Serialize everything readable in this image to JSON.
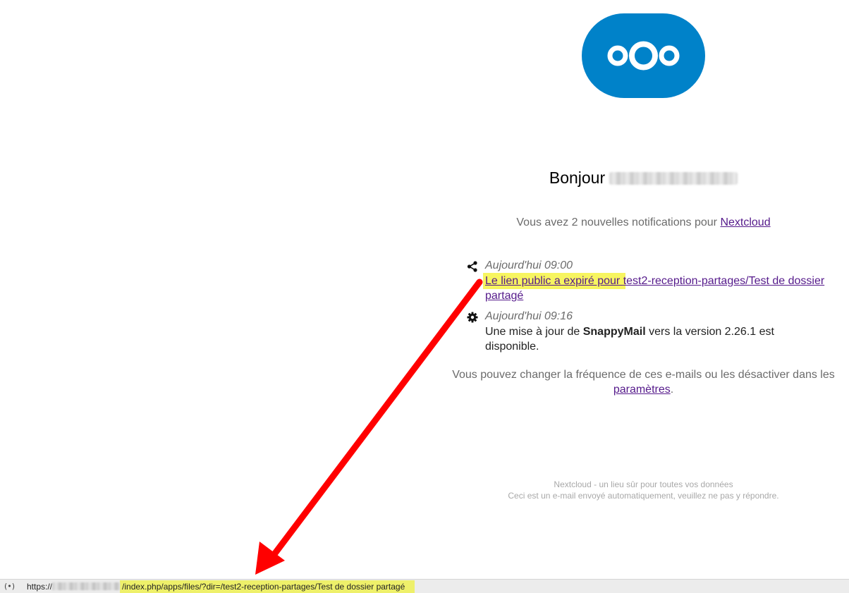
{
  "greeting": {
    "prefix": "Bonjour"
  },
  "intro": {
    "text": "Vous avez 2 nouvelles notifications pour ",
    "link": "Nextcloud"
  },
  "notifications": [
    {
      "icon": "share-icon",
      "time": "Aujourd'hui 09:00",
      "text_highlighted": "Le lien public a expiré pour ",
      "link": "test2-reception-partages/Test de dossier partagé"
    },
    {
      "icon": "gear-icon",
      "time": "Aujourd'hui 09:16",
      "text_before": "Une mise à jour de ",
      "app_name": "SnappyMail",
      "text_after": " vers la version 2.26.1 est disponible."
    }
  ],
  "settings_note": {
    "text": "Vous pouvez changer la fréquence de ces e-mails ou les désactiver dans les ",
    "link": "paramètres",
    "suffix": "."
  },
  "footer": {
    "line1": "Nextcloud - un lieu sûr pour toutes vos données",
    "line2": "Ceci est un e-mail envoyé automatiquement, veuillez ne pas y répondre."
  },
  "statusbar": {
    "icon": "(•)",
    "url_prefix": "https://",
    "url_path": "/index.php/apps/files/?dir=/test2-reception-partages/Test de dossier partagé"
  },
  "colors": {
    "brand": "#0082c9",
    "highlight": "#f7f560",
    "arrow": "#ff0000",
    "link": "#551a8b"
  }
}
